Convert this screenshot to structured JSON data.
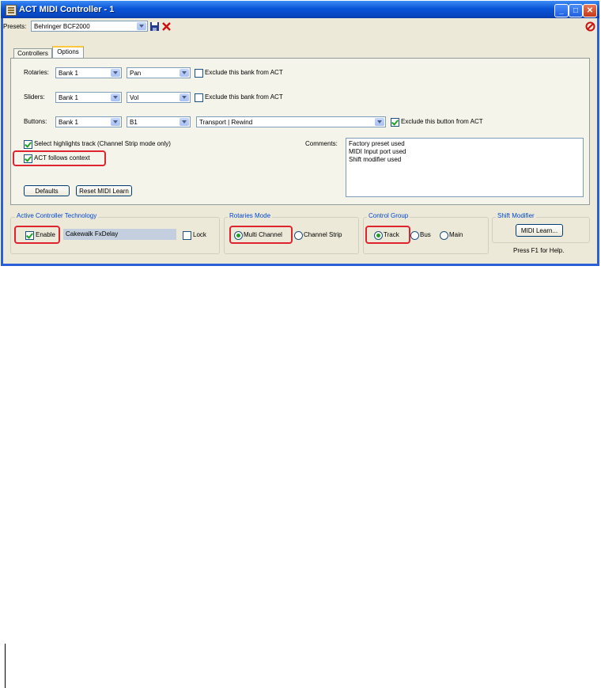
{
  "window": {
    "title": "ACT MIDI Controller - 1"
  },
  "titlebar": {
    "minimize": "_",
    "maximize": "□",
    "close": "✕"
  },
  "presets": {
    "label": "Presets:",
    "value": "Behringer BCF2000",
    "save_icon": "disk-icon",
    "delete_icon": "x-icon",
    "stop_icon": "no-entry-icon"
  },
  "tabs": [
    {
      "label": "Controllers"
    },
    {
      "label": "Options"
    }
  ],
  "options": {
    "rotaries": {
      "label": "Rotaries:",
      "bank": "Bank 1",
      "param": "Pan",
      "exclude": "Exclude this bank from ACT",
      "exclude_checked": false
    },
    "sliders": {
      "label": "Sliders:",
      "bank": "Bank 1",
      "param": "Vol",
      "exclude": "Exclude this bank from ACT",
      "exclude_checked": false
    },
    "buttons": {
      "label": "Buttons:",
      "bank": "Bank 1",
      "button": "B1",
      "action": "Transport | Rewind",
      "exclude": "Exclude this button from ACT",
      "exclude_checked": true
    },
    "select_highlights": {
      "label": "Select highlights track (Channel Strip mode only)",
      "checked": true
    },
    "act_follows": {
      "label": "ACT follows context",
      "checked": true
    },
    "comments_label": "Comments:",
    "comments": [
      "Factory preset used",
      "MIDI Input port used",
      "Shift modifier used"
    ],
    "defaults_button": "Defaults",
    "reset_button": "Reset MIDI Learn"
  },
  "act": {
    "group": "Active Controller Technology",
    "enable": "Enable",
    "enable_checked": true,
    "plugin": "Cakewalk FxDelay",
    "lock": "Lock",
    "lock_checked": false
  },
  "rotaries_mode": {
    "group": "Rotaries Mode",
    "multi": "Multi Channel",
    "strip": "Channel Strip",
    "selected": "Multi Channel"
  },
  "control_group": {
    "group": "Control Group",
    "track": "Track",
    "bus": "Bus",
    "main": "Main",
    "selected": "Track"
  },
  "shift": {
    "group": "Shift Modifier",
    "button": "MIDI Learn...",
    "help": "Press F1 for Help."
  },
  "colors": {
    "highlight": "#e0242f",
    "titlebar": "#0a55d8",
    "group_label": "#0046d5"
  }
}
